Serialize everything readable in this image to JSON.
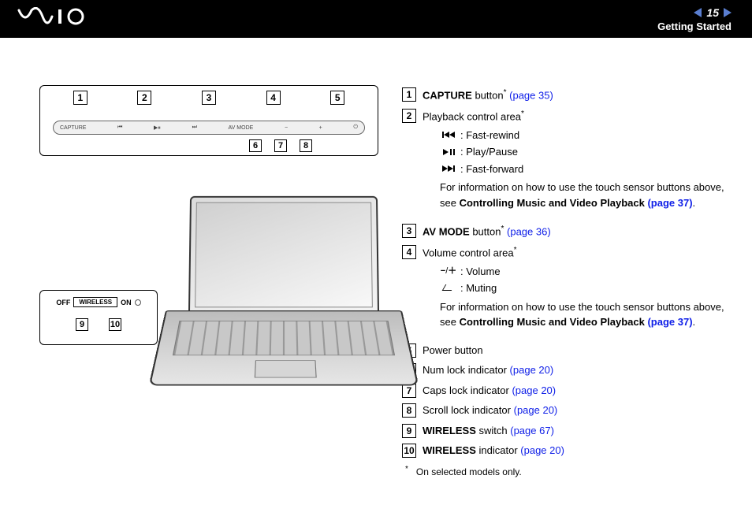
{
  "header": {
    "logo": "VAIO",
    "page_number": "15",
    "section": "Getting Started"
  },
  "diagram": {
    "strip_labels": [
      "CAPTURE",
      "⏮",
      "▶⏸",
      "⏭",
      "AV MODE",
      "−",
      "+",
      "⏻"
    ],
    "switch": {
      "off": "OFF",
      "label": "WIRELESS",
      "on": "ON"
    },
    "callouts_top": [
      "1",
      "2",
      "3",
      "4",
      "5"
    ],
    "callouts_mid": [
      "6",
      "7",
      "8"
    ],
    "callouts_switch": [
      "9",
      "10"
    ]
  },
  "legend": {
    "items": [
      {
        "num": "1",
        "bold": "CAPTURE",
        "text": " button",
        "sup": "*",
        "link": "(page 35)"
      },
      {
        "num": "2",
        "text": "Playback control area",
        "sup": "*",
        "sub": [
          {
            "icon": "rewind",
            "text": ": Fast-rewind"
          },
          {
            "icon": "playpause",
            "text": ": Play/Pause"
          },
          {
            "icon": "forward",
            "text": ": Fast-forward"
          }
        ],
        "note_pre": "For information on how to use the touch sensor buttons above, see ",
        "note_bold": "Controlling Music and Video Playback ",
        "note_link": "(page 37)",
        "note_post": "."
      },
      {
        "num": "3",
        "bold": "AV MODE",
        "text": " button",
        "sup": "*",
        "link": "(page 36)"
      },
      {
        "num": "4",
        "text": "Volume control area",
        "sup": "*",
        "sub": [
          {
            "icon": "volpm",
            "text": ": Volume"
          },
          {
            "icon": "mute",
            "text": ": Muting"
          }
        ],
        "note_pre": "For information on how to use the touch sensor buttons above, see ",
        "note_bold": "Controlling Music and Video Playback ",
        "note_link": "(page 37)",
        "note_post": "."
      },
      {
        "num": "5",
        "text": "Power button"
      },
      {
        "num": "6",
        "text": "Num lock indicator ",
        "link": "(page 20)"
      },
      {
        "num": "7",
        "text": "Caps lock indicator ",
        "link": "(page 20)"
      },
      {
        "num": "8",
        "text": "Scroll lock indicator ",
        "link": "(page 20)"
      },
      {
        "num": "9",
        "bold": "WIRELESS",
        "text": " switch ",
        "link": "(page 67)"
      },
      {
        "num": "10",
        "bold": "WIRELESS",
        "text": " indicator ",
        "link": "(page 20)"
      }
    ],
    "footnote": "On selected models only.",
    "footnote_mark": "*"
  }
}
